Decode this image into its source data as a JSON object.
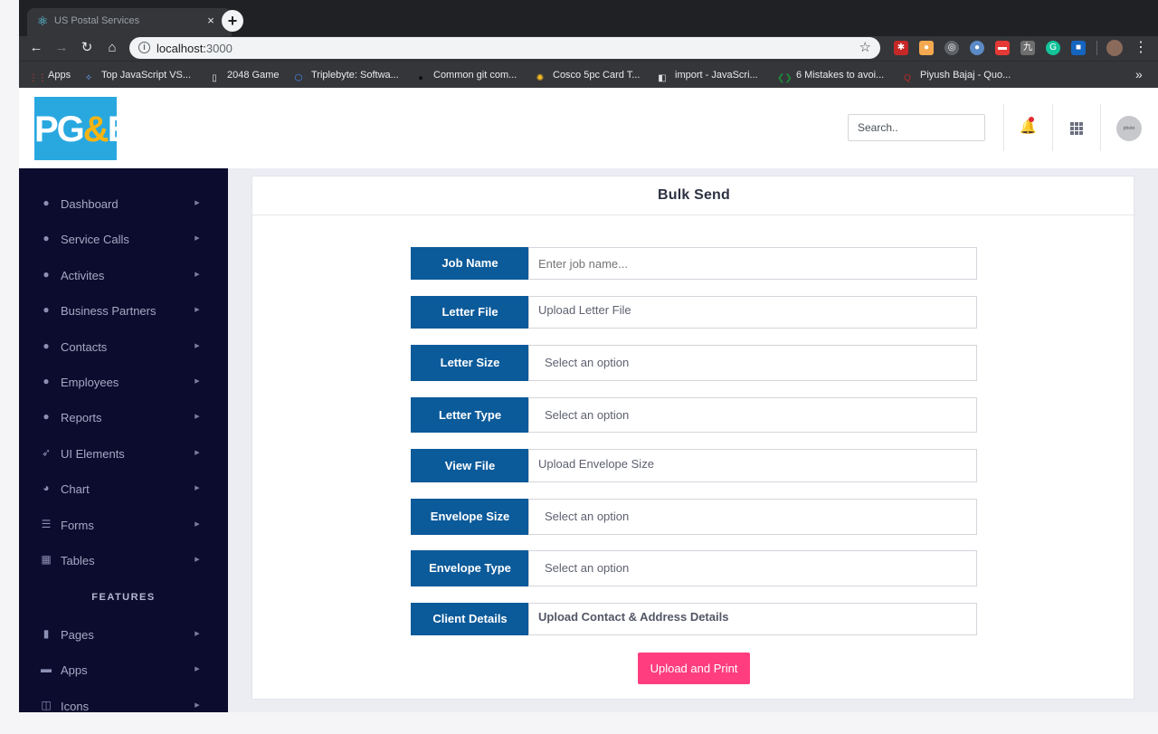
{
  "browser": {
    "tab_title": "US Postal Services",
    "tab_icon": "react-icon",
    "tab_close": "×",
    "new_tab": "+",
    "url_host": "localhost:",
    "url_port": "3000",
    "nav": {
      "back": "←",
      "forward": "→",
      "reload": "↻",
      "home": "⌂",
      "star": "☆",
      "more": "⋮"
    },
    "bookmarks_more": "»",
    "bookmarks": [
      {
        "label": "Apps",
        "icon": "apps-grid-icon",
        "color": "#e94235"
      },
      {
        "label": "Top JavaScript VS...",
        "icon": "sparkle-icon",
        "color": "#6aa9ff"
      },
      {
        "label": "2048 Game",
        "icon": "page-icon",
        "color": "#e8eaed"
      },
      {
        "label": "Triplebyte: Softwa...",
        "icon": "hexagon-icon",
        "color": "#4b8bf5"
      },
      {
        "label": "Common git com...",
        "icon": "github-icon",
        "color": "#111111"
      },
      {
        "label": "Cosco 5pc Card T...",
        "icon": "walmart-icon",
        "color": "#ffc220"
      },
      {
        "label": "import - JavaScri...",
        "icon": "stackoverflow-icon",
        "color": "#e0e0e0"
      },
      {
        "label": "6 Mistakes to avoi...",
        "icon": "code-icon",
        "color": "#1f8a3b"
      },
      {
        "label": "Piyush Bajaj - Quo...",
        "icon": "quora-icon",
        "color": "#b92b27"
      }
    ]
  },
  "header": {
    "logo_text_pg": "PG",
    "logo_text_amp": "&",
    "logo_text_e": "E",
    "search_placeholder": "Search..",
    "avatar_text": "photo"
  },
  "sidebar": {
    "items": [
      {
        "label": "Dashboard",
        "icon": "user-circle-icon",
        "glyph": "●"
      },
      {
        "label": "Service Calls",
        "icon": "user-circle-icon",
        "glyph": "●"
      },
      {
        "label": "Activites",
        "icon": "user-circle-icon",
        "glyph": "●"
      },
      {
        "label": "Business Partners",
        "icon": "user-circle-icon",
        "glyph": "●"
      },
      {
        "label": "Contacts",
        "icon": "user-circle-icon",
        "glyph": "●"
      },
      {
        "label": "Employees",
        "icon": "user-circle-icon",
        "glyph": "●"
      },
      {
        "label": "Reports",
        "icon": "user-circle-icon",
        "glyph": "●"
      },
      {
        "label": "UI Elements",
        "icon": "rocket-icon",
        "glyph": "➶"
      },
      {
        "label": "Chart",
        "icon": "pie-chart-icon",
        "glyph": "◕"
      },
      {
        "label": "Forms",
        "icon": "form-icon",
        "glyph": "☰"
      },
      {
        "label": "Tables",
        "icon": "table-icon",
        "glyph": "▦"
      }
    ],
    "section_label": "FEATURES",
    "feature_items": [
      {
        "label": "Pages",
        "icon": "file-icon",
        "glyph": "▮"
      },
      {
        "label": "Apps",
        "icon": "inbox-icon",
        "glyph": "▬"
      },
      {
        "label": "Icons",
        "icon": "window-icon",
        "glyph": "◫"
      }
    ],
    "caret": "▶"
  },
  "form": {
    "title": "Bulk Send",
    "fields": [
      {
        "label": "Job Name",
        "kind": "input",
        "placeholder": "Enter job name..."
      },
      {
        "label": "Letter File",
        "kind": "upload",
        "value": "Upload Letter File"
      },
      {
        "label": "Letter Size",
        "kind": "select",
        "value": "Select an option"
      },
      {
        "label": "Letter Type",
        "kind": "select",
        "value": "Select an option"
      },
      {
        "label": "View File",
        "kind": "upload",
        "value": "Upload Envelope Size"
      },
      {
        "label": "Envelope Size",
        "kind": "select",
        "value": "Select an option"
      },
      {
        "label": "Envelope Type",
        "kind": "select",
        "value": "Select an option"
      },
      {
        "label": "Client Details",
        "kind": "upload",
        "value": "Upload Contact & Address Details"
      }
    ],
    "submit_label": "Upload and Print",
    "colors": {
      "label_bg": "#0b5a9a",
      "button_bg": "#ff3d7f",
      "sidebar_bg": "#0c0c2e"
    }
  }
}
